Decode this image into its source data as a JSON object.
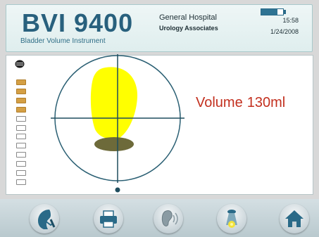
{
  "header": {
    "product_name": "BVI 9400",
    "product_subtitle": "Bladder Volume Instrument",
    "hospital_name": "General Hospital",
    "department": "Urology Associates",
    "time": "15:58",
    "date": "1/24/2008",
    "battery_level_pct": 75
  },
  "scan": {
    "volume_label": "Volume",
    "volume_value": "130ml",
    "scan_planes_total": 12,
    "scan_planes_completed": 4
  },
  "colors": {
    "brand": "#28607d",
    "volume_text": "#c3301f",
    "bladder": "#ffff00",
    "shadow": "#6d6a3a",
    "plane_done": "#d49f44"
  },
  "toolbar": {
    "buttons": [
      {
        "icon": "patient-scan-icon"
      },
      {
        "icon": "printer-icon"
      },
      {
        "icon": "audio-ear-icon"
      },
      {
        "icon": "aim-light-icon"
      },
      {
        "icon": "home-icon"
      }
    ]
  }
}
